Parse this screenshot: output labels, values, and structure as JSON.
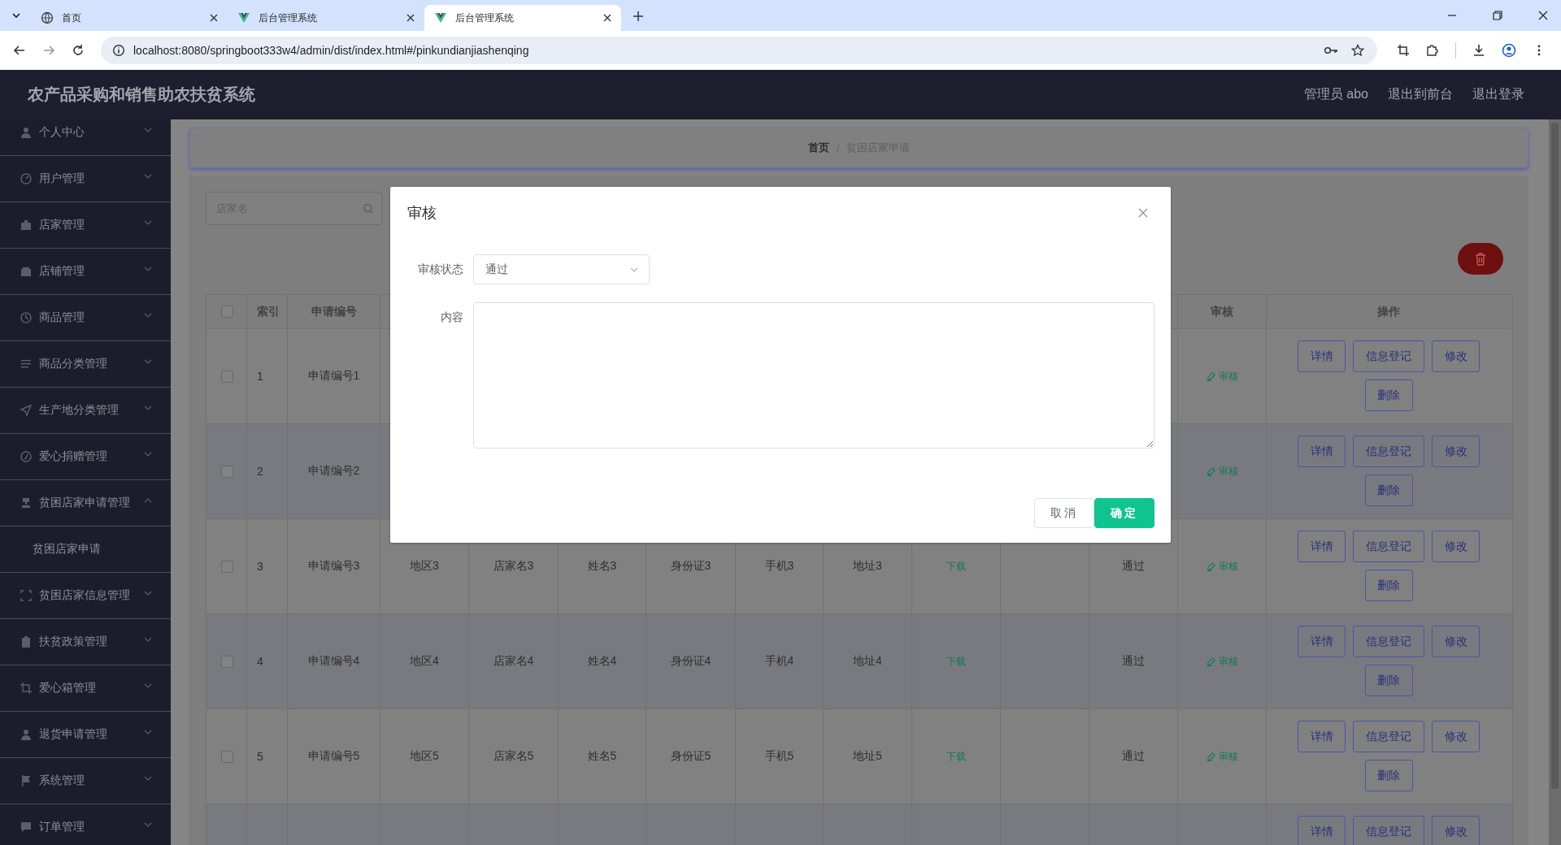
{
  "browser": {
    "tabs": [
      {
        "title": "首页",
        "kind": "globe",
        "selected": false
      },
      {
        "title": "后台管理系统",
        "kind": "vue",
        "selected": false
      },
      {
        "title": "后台管理系统",
        "kind": "vue",
        "selected": true
      }
    ],
    "url": "localhost:8080/springboot333w4/admin/dist/index.html#/pinkundianjiashenqing"
  },
  "header": {
    "title": "农产品采购和销售助农扶贫系统",
    "links": [
      "管理员 abo",
      "退出到前台",
      "退出登录"
    ]
  },
  "sidebar": {
    "items": [
      {
        "label": "个人中心",
        "kind": "user",
        "expanded": false
      },
      {
        "label": "用户管理",
        "kind": "gauge",
        "expanded": false
      },
      {
        "label": "店家管理",
        "kind": "briefcase",
        "expanded": false
      },
      {
        "label": "店铺管理",
        "kind": "wallet",
        "expanded": false
      },
      {
        "label": "商品管理",
        "kind": "clock",
        "expanded": false
      },
      {
        "label": "商品分类管理",
        "kind": "list",
        "expanded": false
      },
      {
        "label": "生产地分类管理",
        "kind": "navigation",
        "expanded": false
      },
      {
        "label": "爱心捐赠管理",
        "kind": "compass",
        "expanded": false
      },
      {
        "label": "贫困店家申请管理",
        "kind": "stamp",
        "expanded": true,
        "children": [
          {
            "label": "贫困店家申请"
          }
        ]
      },
      {
        "label": "贫困店家信息管理",
        "kind": "fullscreen",
        "expanded": false
      },
      {
        "label": "扶贫政策管理",
        "kind": "clipboard",
        "expanded": false
      },
      {
        "label": "爱心箱管理",
        "kind": "crop",
        "expanded": false
      },
      {
        "label": "退货申请管理",
        "kind": "user",
        "expanded": false
      },
      {
        "label": "系统管理",
        "kind": "flag",
        "expanded": false
      },
      {
        "label": "订单管理",
        "kind": "chat",
        "expanded": false
      }
    ]
  },
  "breadcrumb": {
    "separator": "/",
    "items": [
      "首页",
      "贫困店家申请"
    ]
  },
  "search": {
    "placeholder": "店家名"
  },
  "table": {
    "select_all_checked": false,
    "headers": {
      "index": "索引",
      "apply_no": "申请编号",
      "review": "审核",
      "actions": "操作"
    },
    "rows": [
      {
        "checked": false,
        "index": "1",
        "apply_no": "申请编号1",
        "review": "审核",
        "actions": [
          "详情",
          "信息登记",
          "修改",
          "删除"
        ]
      },
      {
        "checked": false,
        "index": "2",
        "apply_no": "申请编号2",
        "review": "审核",
        "actions": [
          "详情",
          "信息登记",
          "修改",
          "删除"
        ]
      },
      {
        "checked": false,
        "index": "3",
        "apply_no": "申请编号3",
        "region": "地区3",
        "shop_name": "店家名3",
        "name": "姓名3",
        "id_card": "身份证3",
        "phone": "手机3",
        "address": "地址3",
        "column_10": "下载",
        "status": "通过",
        "review": "审核",
        "actions": [
          "详情",
          "信息登记",
          "修改",
          "删除"
        ]
      },
      {
        "checked": false,
        "index": "4",
        "apply_no": "申请编号4",
        "region": "地区4",
        "shop_name": "店家名4",
        "name": "姓名4",
        "id_card": "身份证4",
        "phone": "手机4",
        "address": "地址4",
        "column_10": "下载",
        "status": "通过",
        "review": "审核",
        "actions": [
          "详情",
          "信息登记",
          "修改",
          "删除"
        ]
      },
      {
        "checked": false,
        "index": "5",
        "apply_no": "申请编号5",
        "region": "地区5",
        "shop_name": "店家名5",
        "name": "姓名5",
        "id_card": "身份证5",
        "phone": "手机5",
        "address": "地址5",
        "column_10": "下载",
        "status": "通过",
        "review": "审核",
        "actions": [
          "详情",
          "信息登记",
          "修改",
          "删除"
        ]
      },
      {
        "actions": [
          "详情",
          "信息登记",
          "修改"
        ]
      }
    ]
  },
  "dialog": {
    "title": "审核",
    "fields": [
      {
        "kind": "select",
        "label": "审核状态",
        "value": "通过"
      },
      {
        "kind": "textarea",
        "label": "内容"
      }
    ],
    "buttons": [
      {
        "kind": "default",
        "label": "取消"
      },
      {
        "kind": "primary",
        "label": "确定"
      }
    ]
  }
}
